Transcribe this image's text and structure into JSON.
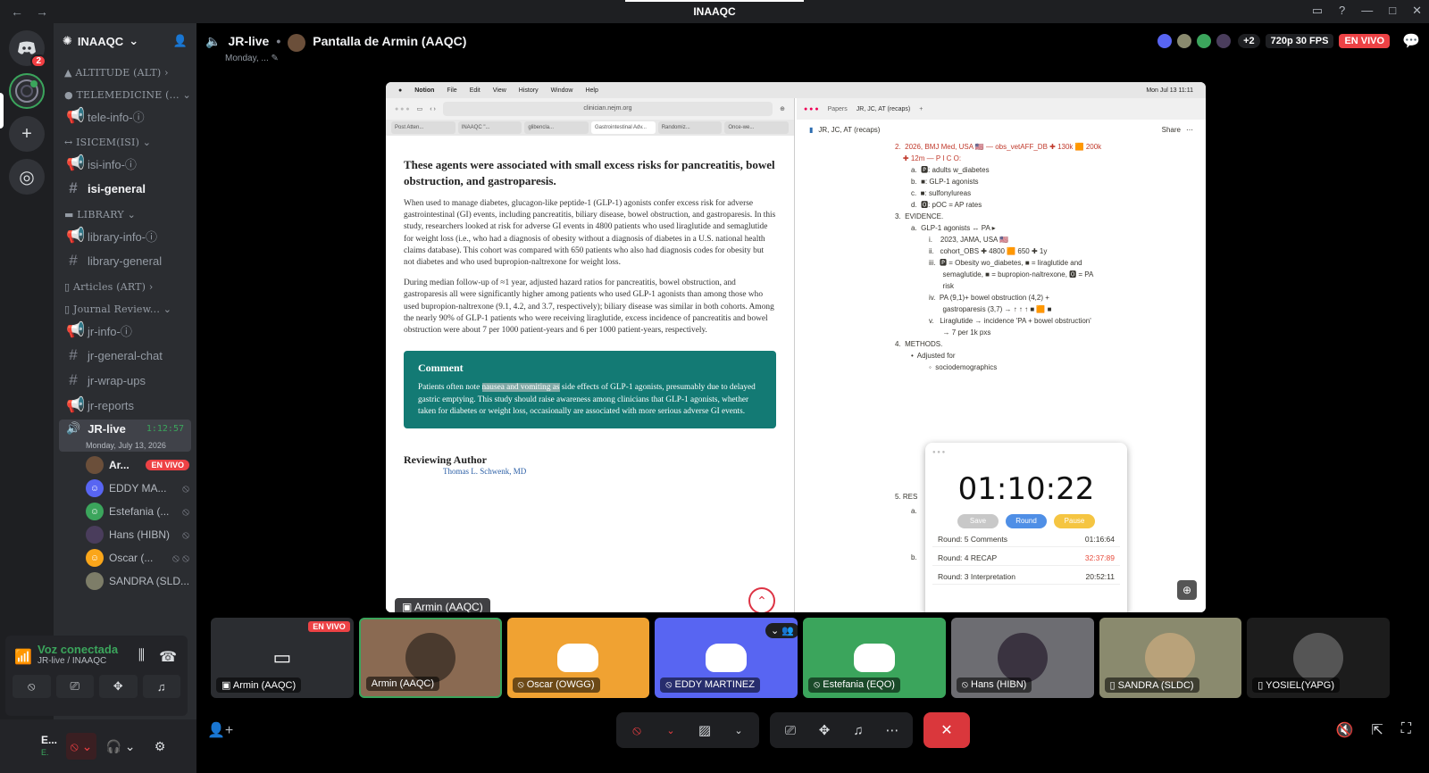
{
  "window": {
    "title": "INAAQC"
  },
  "server": {
    "name": "INAAQC",
    "home_badge": "2"
  },
  "sidebar": {
    "categories": [
      {
        "label": "ALTITUDE (ALT)"
      },
      {
        "label": "TELEMEDICINE (..."
      },
      {
        "label": "ISICEM(ISI)"
      },
      {
        "label": "LIBRARY"
      },
      {
        "label": "Articles (ART)"
      },
      {
        "label": "Journal Review..."
      }
    ],
    "channels": {
      "tele_info": "tele-info-ⓘ",
      "isi_info": "isi-info-ⓘ",
      "isi_general": "isi-general",
      "library_info": "library-info-ⓘ",
      "library_general": "library-general",
      "jr_info": "jr-info-ⓘ",
      "jr_general_chat": "jr-general-chat",
      "jr_wrap_ups": "jr-wrap-ups",
      "jr_reports": "jr-reports"
    },
    "voice_channel": {
      "name": "JR-live",
      "time": "1:12:57",
      "date": "Monday, July 13, 2026"
    },
    "members": [
      {
        "name": "Ar...",
        "color": "#6b4f3a"
      },
      {
        "name": "EDDY MA...",
        "color": "#5865f2"
      },
      {
        "name": "Estefania (...",
        "color": "#3ba55c"
      },
      {
        "name": "Hans (HIBN)",
        "color": "#4a3d5c"
      },
      {
        "name": "Oscar (...",
        "color": "#faa61a"
      },
      {
        "name": "SANDRA (SLD...",
        "color": "#7d7d68"
      },
      {
        "name": "YOSIEL(YAPG)",
        "color": "#444"
      }
    ],
    "live_label": "EN VIVO"
  },
  "voice_panel": {
    "status": "Voz conectada",
    "location": "JR-live / INAAQC"
  },
  "user": {
    "name": "E...",
    "sub": "E."
  },
  "stage": {
    "channel": "JR-live",
    "stream": "Pantalla de Armin (AAQC)",
    "subtitle": "Monday, ...",
    "quality": "720p 30 FPS",
    "live": "EN VIVO",
    "extra_count": "+2"
  },
  "screen": {
    "menu": [
      "Notion",
      "File",
      "Edit",
      "View",
      "History",
      "Window",
      "Help"
    ],
    "clock": "Mon Jul 13  11:11",
    "url": "clinician.nejm.org",
    "tabs": [
      "Post Atten...",
      "INAAQC \"...",
      "glibencla...",
      "Gastrointestinal Adv...",
      "Randomiz...",
      "Once-we..."
    ],
    "article": {
      "heading": "These agents were associated with small excess risks for pancreatitis, bowel obstruction, and gastroparesis.",
      "p1": "When used to manage diabetes, glucagon-like peptide-1 (GLP-1) agonists confer excess risk for adverse gastrointestinal (GI) events, including pancreatitis, biliary disease, bowel obstruction, and gastroparesis. In this study, researchers looked at risk for adverse GI events in 4800 patients who used liraglutide and semaglutide for weight loss (i.e., who had a diagnosis of obesity without a diagnosis of diabetes in a U.S. national health claims database). This cohort was compared with 650 patients who also had diagnosis codes for obesity but not diabetes and who used bupropion-naltrexone for weight loss.",
      "p2": "During median follow-up of ≈1 year, adjusted hazard ratios for pancreatitis, bowel obstruction, and gastroparesis all were significantly higher among patients who used GLP-1 agonists than among those who used bupropion-naltrexone (9.1, 4.2, and 3.7, respectively); biliary disease was similar in both cohorts. Among the nearly 90% of GLP-1 patients who were receiving liraglutide, excess incidence of pancreatitis and bowel obstruction were about 7 per 1000 patient-years and 6 per 1000 patient-years, respectively.",
      "comment_title": "Comment",
      "comment_pre": "Patients often note ",
      "comment_hl": "nausea and vomiting as",
      "comment_post": " side effects of GLP-1 agonists, presumably due to delayed gastric emptying. This study should raise awareness among clinicians that GLP-1 agonists, whether taken for diabetes or weight loss, occasionally are associated with more serious adverse GI events.",
      "reviewing": "Reviewing Author",
      "reviewer": "Thomas L. Schwenk, MD",
      "speaker_tag": "Armin (AAQC)"
    },
    "notion": {
      "page": "JR, JC, AT (recaps)",
      "tab1": "Papers",
      "tab2": "JR, JC, AT (recaps)",
      "share": "Share",
      "lines": [
        {
          "cls": "l1 red",
          "t": "2.  2026, BMJ Med, USA 🇺🇸 — obs_vetAFF_DB ✚ 130k 🟧 200k"
        },
        {
          "cls": "l1 red",
          "t": "    ✚ 12m — P I C O:"
        },
        {
          "cls": "l2",
          "t": "a.  🅿: adults w_diabetes"
        },
        {
          "cls": "l2",
          "t": "b.  ■: GLP-1 agonists"
        },
        {
          "cls": "l2",
          "t": "c.  ■: sulfonylureas"
        },
        {
          "cls": "l2",
          "t": "d.  🅾: pOC = AP rates"
        },
        {
          "cls": "l1",
          "t": "3.  EVIDENCE."
        },
        {
          "cls": "l2",
          "t": "a.  GLP-1 agonists ↔ PA ▸"
        },
        {
          "cls": "l3",
          "t": "i.    2023, JAMA, USA 🇺🇸"
        },
        {
          "cls": "l3",
          "t": "ii.   cohort_OBS ✚ 4800 🟧 650 ✚ 1y"
        },
        {
          "cls": "l3",
          "t": "iii.  🅿 = Obesity wo_diabetes, ■ = liraglutide and"
        },
        {
          "cls": "l3",
          "t": "       semaglutide, ■ = bupropion-naltrexone, 🅾 = PA"
        },
        {
          "cls": "l3",
          "t": "       risk"
        },
        {
          "cls": "l3",
          "t": "iv.  PA (9,1)+ bowel obstruction (4,2) +"
        },
        {
          "cls": "l3",
          "t": "       gastroparesis (3,7) → ↑ ↑ ↑ ■ 🟧 ■"
        },
        {
          "cls": "l3",
          "t": "v.   Liraglutide → incidence 'PA + bowel obstruction'"
        },
        {
          "cls": "l3",
          "t": "       → 7 per 1k pxs"
        },
        {
          "cls": "l1",
          "t": "4.  METHODS."
        },
        {
          "cls": "l2",
          "t": "•  Adjusted for"
        },
        {
          "cls": "l3",
          "t": "◦  sociodemographics"
        }
      ],
      "partial_5": "5.  RES",
      "partial_a": "a.",
      "partial_b": "b."
    },
    "timer": {
      "time": "01:10:22",
      "save": "Save",
      "round": "Round",
      "pause": "Pause",
      "rounds": [
        {
          "label": "Round: 5  Comments",
          "time": "01:16:64",
          "red": false
        },
        {
          "label": "Round: 4  RECAP",
          "time": "32:37:89",
          "red": true
        },
        {
          "label": "Round: 3  Interpretation",
          "time": "20:52:11",
          "red": false
        }
      ]
    }
  },
  "tiles": [
    {
      "name": "Armin (AAQC)",
      "bg": "#2b2d31",
      "live": "EN VIVO",
      "kind": "screen"
    },
    {
      "name": "Armin (AAQC)",
      "bg": "#8a6a52",
      "kind": "cam"
    },
    {
      "name": "Oscar (OWGG)",
      "bg": "#f0a232",
      "kind": "logo"
    },
    {
      "name": "EDDY MARTINEZ",
      "bg": "#5865f2",
      "kind": "logo"
    },
    {
      "name": "Estefania (EQO)",
      "bg": "#3ba55c",
      "kind": "logo"
    },
    {
      "name": "Hans (HIBN)",
      "bg": "#6d6d72",
      "kind": "cam"
    },
    {
      "name": "SANDRA (SLDC)",
      "bg": "#8a8a6e",
      "kind": "cam"
    },
    {
      "name": "YOSIEL(YAPG)",
      "bg": "#1c1c1c",
      "kind": "cam"
    }
  ],
  "colors": {
    "accent": "#5865f2",
    "green": "#3ba55c",
    "red": "#ed4245"
  }
}
